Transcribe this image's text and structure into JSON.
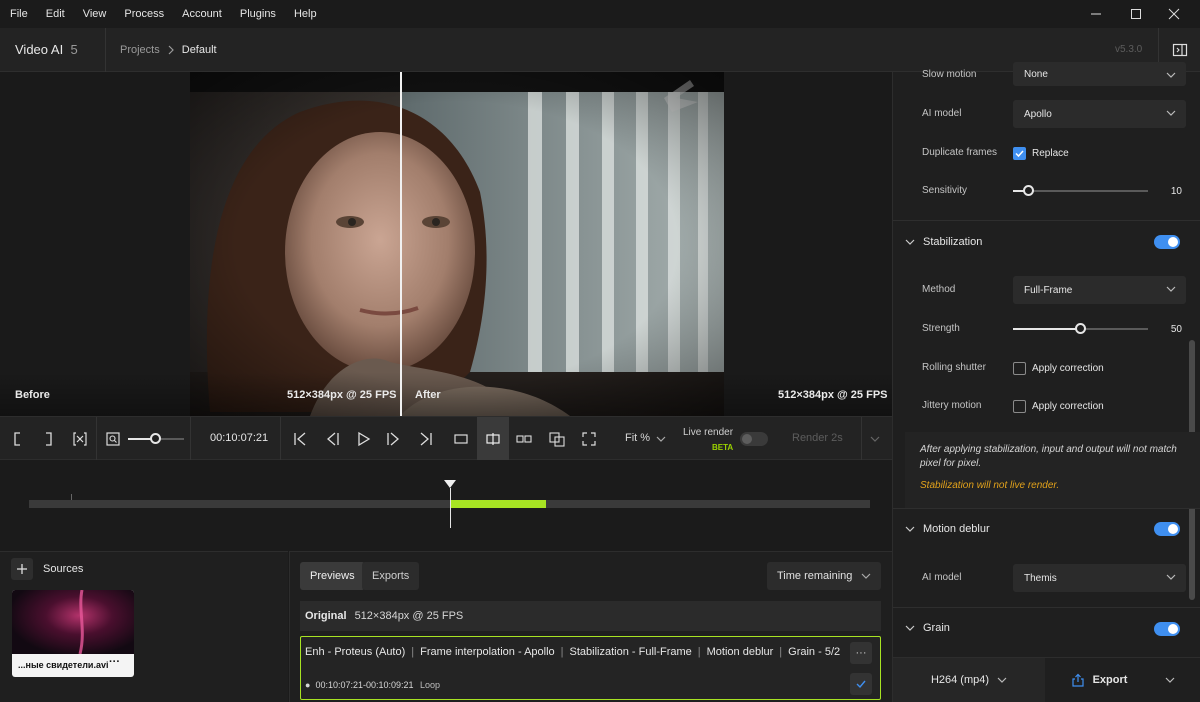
{
  "menu": [
    "File",
    "Edit",
    "View",
    "Process",
    "Account",
    "Plugins",
    "Help"
  ],
  "app": {
    "name": "Video AI",
    "version_num": "5",
    "version": "v5.3.0"
  },
  "breadcrumb": {
    "root": "Projects",
    "current": "Default"
  },
  "viewer": {
    "before_label": "Before",
    "before_spec": "512×384px @ 25 FPS",
    "after_label": "After",
    "after_spec": "512×384px @ 25 FPS"
  },
  "toolbar": {
    "timecode": "00:10:07:21",
    "fit": "Fit %",
    "live_render": "Live render",
    "beta": "BETA",
    "render": "Render 2s",
    "zoom_level": 0.5
  },
  "timeline": {
    "playhead_fraction": 0.5
  },
  "sources": {
    "title": "Sources",
    "file_name": "...ные свидетели.avi",
    "more": "···"
  },
  "previews": {
    "tabs": [
      "Previews",
      "Exports"
    ],
    "sort": "Time remaining",
    "original_label": "Original",
    "original_spec": "512×384px @ 25 FPS",
    "steps": [
      "Enh - Proteus (Auto)",
      "Frame interpolation - Apollo",
      "Stabilization - Full-Frame",
      "Motion deblur",
      "Grain - 5/2"
    ],
    "range": "00:10:07:21-00:10:09:21",
    "loop": "Loop",
    "more": "···"
  },
  "panel": {
    "slow_motion_label": "Slow motion",
    "slow_motion_value": "None",
    "ai_model_label": "AI model",
    "ai_model_value": "Apollo",
    "duplicate_frames_label": "Duplicate frames",
    "duplicate_frames_option": "Replace",
    "sensitivity_label": "Sensitivity",
    "sensitivity_value": 10,
    "sensitivity_fraction": 0.12,
    "stabilization_title": "Stabilization",
    "method_label": "Method",
    "method_value": "Full-Frame",
    "strength_label": "Strength",
    "strength_value": 50,
    "strength_fraction": 0.5,
    "rolling_shutter_label": "Rolling shutter",
    "jittery_motion_label": "Jittery motion",
    "apply_correction": "Apply correction",
    "stab_note": "After applying stabilization, input and output will not match pixel for pixel.",
    "stab_warning": "Stabilization will not live render.",
    "motion_deblur_title": "Motion deblur",
    "deblur_model_label": "AI model",
    "deblur_model_value": "Themis",
    "grain_title": "Grain"
  },
  "export": {
    "format": "H264 (mp4)",
    "button": "Export"
  },
  "colors": {
    "accent_green": "#a7e323",
    "toggle_blue": "#3f8ff0",
    "warning": "#e2a21b"
  }
}
